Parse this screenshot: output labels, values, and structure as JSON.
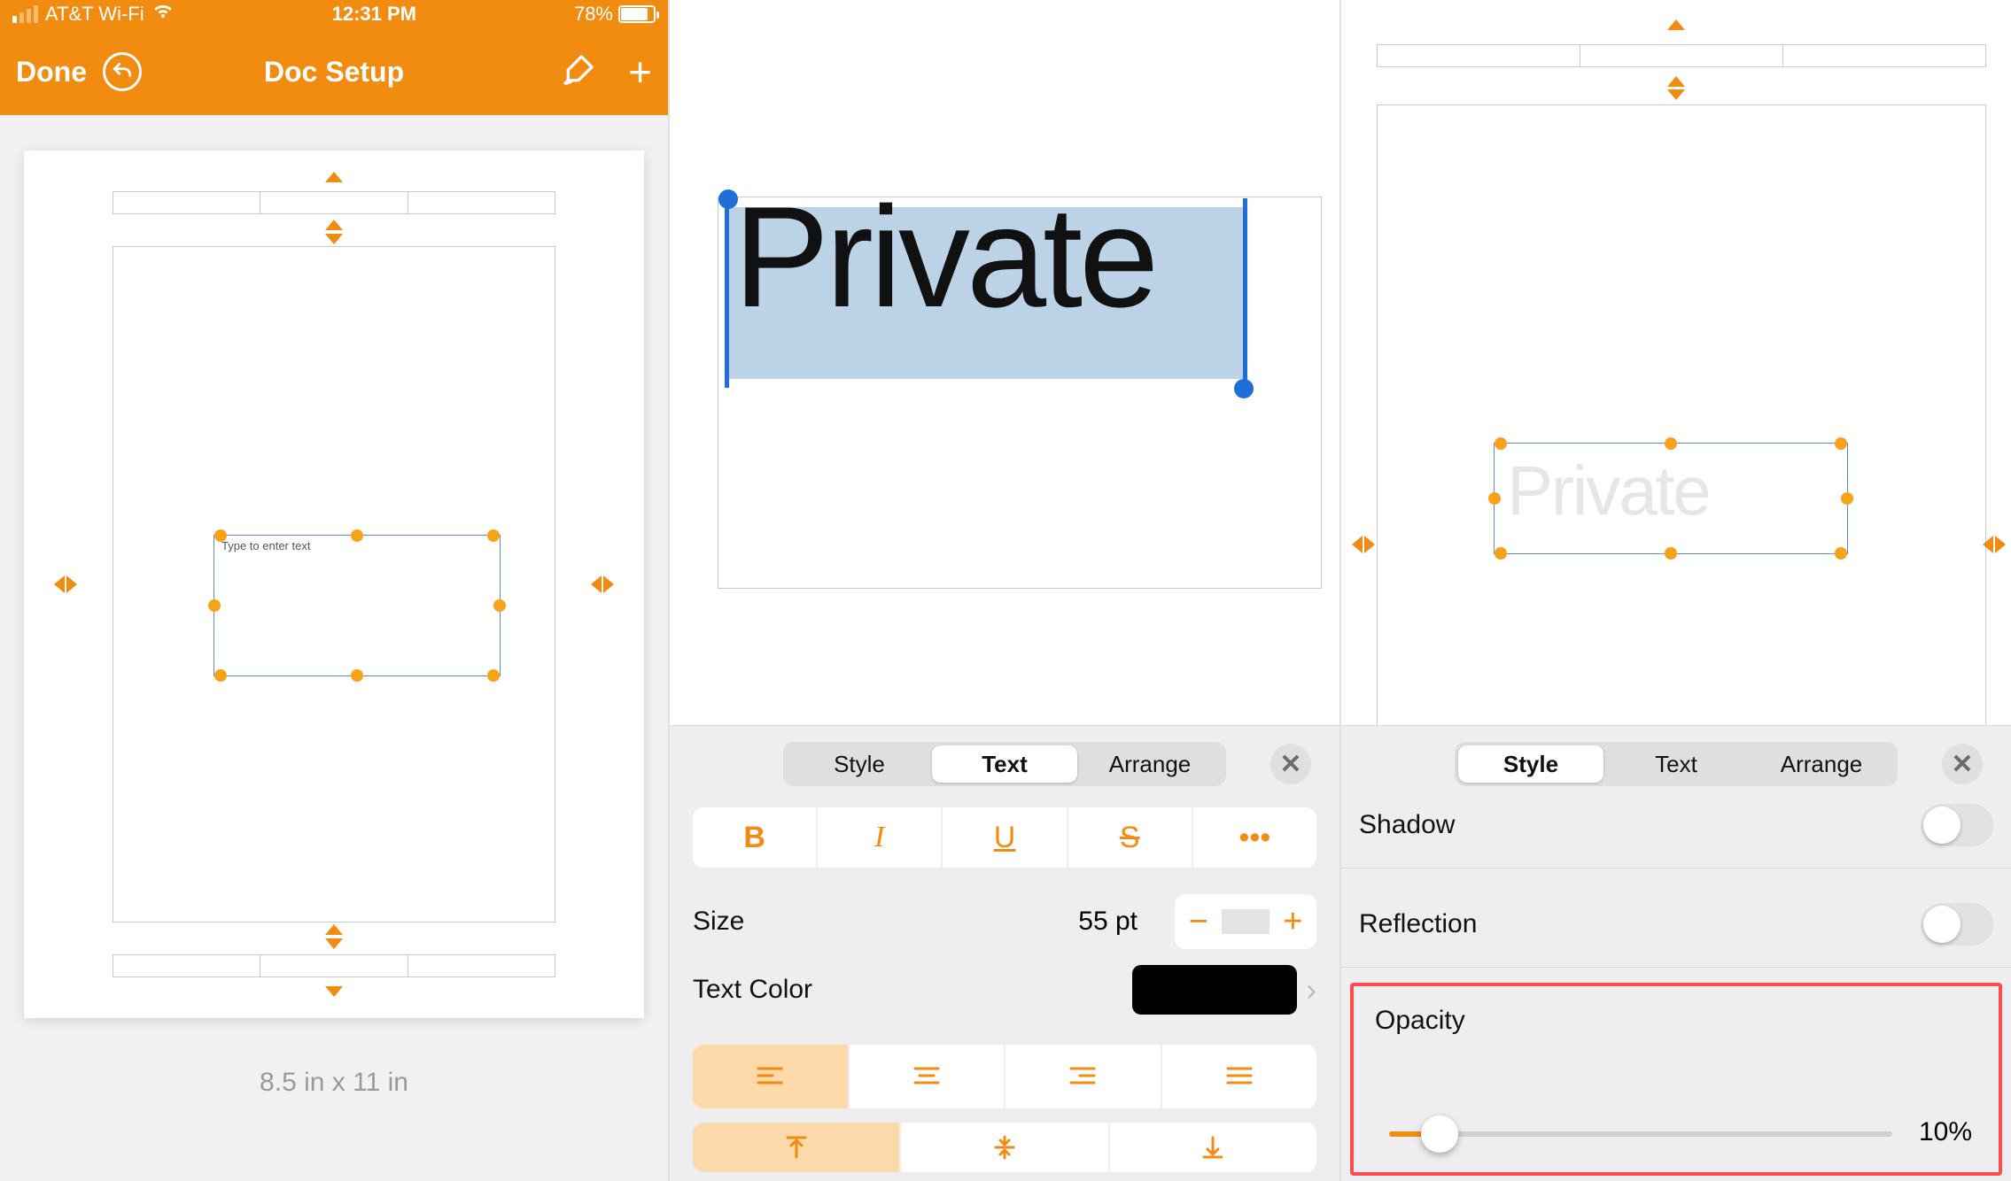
{
  "panel1": {
    "status": {
      "carrier": "AT&T Wi-Fi",
      "time": "12:31 PM",
      "battery": "78%"
    },
    "toolbar": {
      "done": "Done",
      "title": "Doc Setup"
    },
    "textbox_placeholder": "Type to enter text",
    "dimensions": "8.5 in x 11 in"
  },
  "panel2": {
    "text": "Private",
    "tabs": {
      "style": "Style",
      "text": "Text",
      "arrange": "Arrange",
      "active": "Text"
    },
    "size": {
      "label": "Size",
      "value": "55 pt"
    },
    "textcolor": {
      "label": "Text Color",
      "swatch": "#000000"
    }
  },
  "panel3": {
    "text": "Private",
    "tabs": {
      "style": "Style",
      "text": "Text",
      "arrange": "Arrange",
      "active": "Style"
    },
    "shadow": {
      "label": "Shadow",
      "on": false
    },
    "reflection": {
      "label": "Reflection",
      "on": false
    },
    "opacity": {
      "label": "Opacity",
      "value": "10%",
      "percent": 10
    }
  }
}
